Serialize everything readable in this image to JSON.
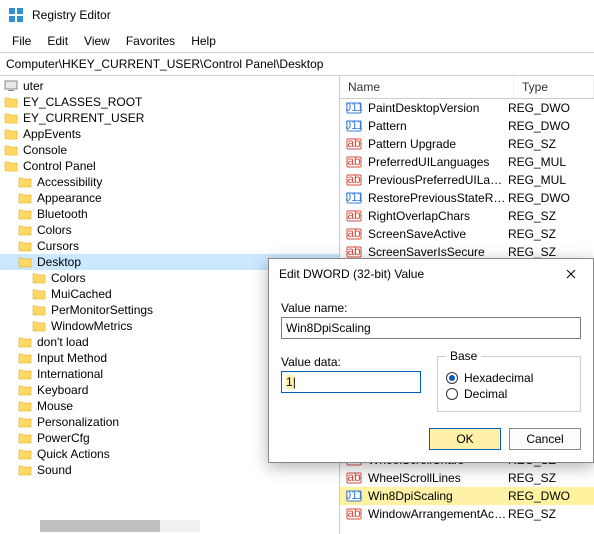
{
  "window": {
    "title": "Registry Editor"
  },
  "menu": {
    "file": "File",
    "edit": "Edit",
    "view": "View",
    "favorites": "Favorites",
    "help": "Help"
  },
  "address": {
    "value": "Computer\\HKEY_CURRENT_USER\\Control Panel\\Desktop"
  },
  "tree": {
    "items": [
      {
        "label": "uter",
        "indent": 0,
        "icon": "computer"
      },
      {
        "label": "EY_CLASSES_ROOT",
        "indent": 0,
        "icon": "folder"
      },
      {
        "label": "EY_CURRENT_USER",
        "indent": 0,
        "icon": "folder"
      },
      {
        "label": "AppEvents",
        "indent": 0,
        "icon": "folder"
      },
      {
        "label": "Console",
        "indent": 0,
        "icon": "folder"
      },
      {
        "label": "Control Panel",
        "indent": 0,
        "icon": "folder"
      },
      {
        "label": "Accessibility",
        "indent": 1,
        "icon": "folder"
      },
      {
        "label": "Appearance",
        "indent": 1,
        "icon": "folder"
      },
      {
        "label": "Bluetooth",
        "indent": 1,
        "icon": "folder"
      },
      {
        "label": "Colors",
        "indent": 1,
        "icon": "folder"
      },
      {
        "label": "Cursors",
        "indent": 1,
        "icon": "folder"
      },
      {
        "label": "Desktop",
        "indent": 1,
        "icon": "folder",
        "selected": true
      },
      {
        "label": "Colors",
        "indent": 2,
        "icon": "folder"
      },
      {
        "label": "MuiCached",
        "indent": 2,
        "icon": "folder"
      },
      {
        "label": "PerMonitorSettings",
        "indent": 2,
        "icon": "folder"
      },
      {
        "label": "WindowMetrics",
        "indent": 2,
        "icon": "folder"
      },
      {
        "label": "don't load",
        "indent": 1,
        "icon": "folder"
      },
      {
        "label": "Input Method",
        "indent": 1,
        "icon": "folder"
      },
      {
        "label": "International",
        "indent": 1,
        "icon": "folder"
      },
      {
        "label": "Keyboard",
        "indent": 1,
        "icon": "folder"
      },
      {
        "label": "Mouse",
        "indent": 1,
        "icon": "folder"
      },
      {
        "label": "Personalization",
        "indent": 1,
        "icon": "folder"
      },
      {
        "label": "PowerCfg",
        "indent": 1,
        "icon": "folder"
      },
      {
        "label": "Quick Actions",
        "indent": 1,
        "icon": "folder"
      },
      {
        "label": "Sound",
        "indent": 1,
        "icon": "folder"
      }
    ]
  },
  "list": {
    "columns": {
      "name": "Name",
      "type": "Type"
    },
    "rows": [
      {
        "name": "PaintDesktopVersion",
        "type": "REG_DWO",
        "icon": "num"
      },
      {
        "name": "Pattern",
        "type": "REG_DWO",
        "icon": "num"
      },
      {
        "name": "Pattern Upgrade",
        "type": "REG_SZ",
        "icon": "str"
      },
      {
        "name": "PreferredUILanguages",
        "type": "REG_MUL",
        "icon": "str"
      },
      {
        "name": "PreviousPreferredUILanguages",
        "type": "REG_MUL",
        "icon": "str"
      },
      {
        "name": "RestorePreviousStateRecalcBe...",
        "type": "REG_DWO",
        "icon": "num"
      },
      {
        "name": "RightOverlapChars",
        "type": "REG_SZ",
        "icon": "str"
      },
      {
        "name": "ScreenSaveActive",
        "type": "REG_SZ",
        "icon": "str"
      },
      {
        "name": "ScreenSaverIsSecure",
        "type": "REG_SZ",
        "icon": "str"
      },
      {
        "name": "",
        "type": "",
        "icon": ""
      },
      {
        "name": "",
        "type": "",
        "icon": ""
      },
      {
        "name": "",
        "type": "",
        "icon": ""
      },
      {
        "name": "",
        "type": "",
        "icon": ""
      },
      {
        "name": "",
        "type": "",
        "icon": ""
      },
      {
        "name": "",
        "type": "",
        "icon": ""
      },
      {
        "name": "",
        "type": "",
        "icon": ""
      },
      {
        "name": "",
        "type": "",
        "icon": ""
      },
      {
        "name": "",
        "type": "",
        "icon": ""
      },
      {
        "name": "",
        "type": "",
        "icon": ""
      },
      {
        "name": "WheelScrollChars",
        "type": "REG_SZ",
        "icon": "str"
      },
      {
        "name": "WheelScrollLines",
        "type": "REG_SZ",
        "icon": "str"
      },
      {
        "name": "Win8DpiScaling",
        "type": "REG_DWO",
        "icon": "num",
        "selected": true
      },
      {
        "name": "WindowArrangementActive",
        "type": "REG_SZ",
        "icon": "str"
      }
    ]
  },
  "dialog": {
    "title": "Edit DWORD (32-bit) Value",
    "value_name_label": "Value name:",
    "value_name": "Win8DpiScaling",
    "value_data_label": "Value data:",
    "value_data": "1",
    "base_label": "Base",
    "hex_label": "Hexadecimal",
    "dec_label": "Decimal",
    "ok": "OK",
    "cancel": "Cancel"
  }
}
